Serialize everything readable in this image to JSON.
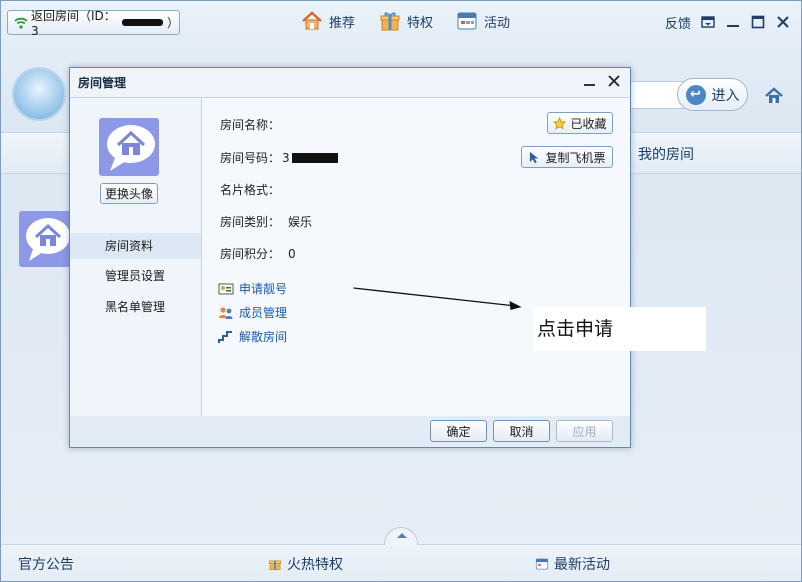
{
  "topbar": {
    "back_room_label": "返回房间（ID：3",
    "back_room_suffix": "）",
    "nav": [
      {
        "label": "推荐",
        "icon": "house-icon"
      },
      {
        "label": "特权",
        "icon": "gift-icon"
      },
      {
        "label": "活动",
        "icon": "calendar-icon"
      }
    ],
    "feedback_label": "反馈"
  },
  "main": {
    "enter_label": "进入",
    "my_room_label": "我的房间"
  },
  "bottom": {
    "notice_label": "官方公告",
    "hot_priv_label": "火热特权",
    "new_act_label": "最新活动"
  },
  "dialog": {
    "title": "房间管理",
    "change_avatar_label": "更换头像",
    "side_items": [
      "房间资料",
      "管理员设置",
      "黑名单管理"
    ],
    "fields": {
      "name_label": "房间名称：",
      "number_label": "房间号码：",
      "number_prefix": "3",
      "card_label": "名片格式：",
      "category_label": "房间类别：",
      "category_value": "娱乐",
      "points_label": "房间积分：",
      "points_value": "0"
    },
    "fav_label": "已收藏",
    "copy_label": "复制飞机票",
    "links": [
      "申请靓号",
      "成员管理",
      "解散房间"
    ],
    "annotation": "点击申请",
    "buttons": {
      "ok": "确定",
      "cancel": "取消",
      "apply": "应用"
    }
  },
  "colors": {
    "accent": "#1c5aa8",
    "frame": "#5f88b4"
  }
}
